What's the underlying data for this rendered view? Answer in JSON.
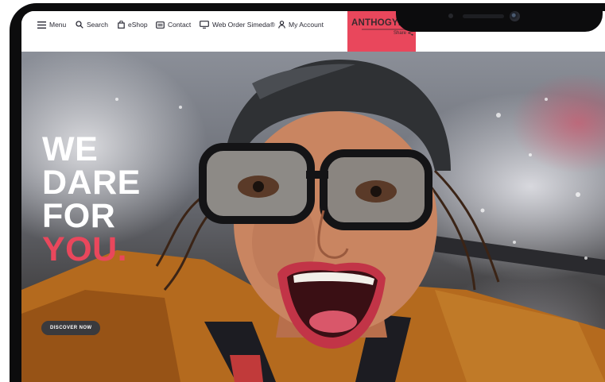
{
  "nav": {
    "menu": "Menu",
    "search": "Search",
    "eshop": "eShop",
    "contact": "Contact",
    "web_order": "Web Order Simeda®",
    "my_account": "My Account"
  },
  "brand": {
    "name": "ANTHOGYR",
    "share": "Share",
    "accent_color": "#e9475c"
  },
  "hero": {
    "line1": "WE",
    "line2": "DARE",
    "line3": "FOR",
    "line4": "YOU.",
    "cta": "DISCOVER NOW"
  },
  "icons": [
    "menu-icon",
    "search-icon",
    "bag-icon",
    "contact-icon",
    "monitor-icon",
    "user-icon",
    "share-icon",
    "camera-icon"
  ]
}
